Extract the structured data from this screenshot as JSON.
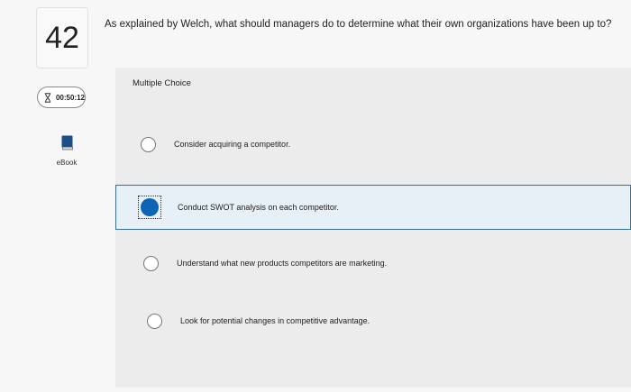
{
  "question": {
    "number": "42",
    "timer": "00:50:12",
    "ebook_label": "eBook",
    "text": "As explained by Welch, what should managers do to determine what their own organizations have been up to?",
    "type_label": "Multiple Choice"
  },
  "choices": [
    {
      "text": "Consider acquiring a competitor.",
      "selected": false
    },
    {
      "text": "Conduct SWOT analysis on each competitor.",
      "selected": true
    },
    {
      "text": "Understand what new products competitors are marketing.",
      "selected": false
    },
    {
      "text": "Look for potential changes in competitive advantage.",
      "selected": false
    }
  ],
  "colors": {
    "selected_radio": "#0d63b4",
    "selected_row_border": "#3a6f94"
  },
  "icons": {
    "timer": "hourglass-icon",
    "ebook": "book-icon"
  }
}
